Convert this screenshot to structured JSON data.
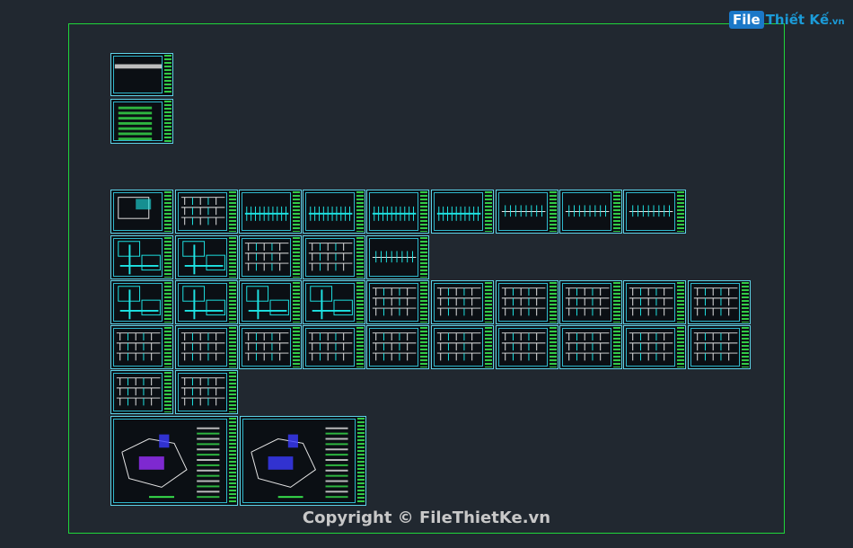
{
  "watermark": {
    "logo_prefix": "File",
    "logo_text": "Thiết Kế",
    "logo_suffix": ".vn",
    "copyright": "Copyright © FileThietKe.vn"
  },
  "colors": {
    "background": "#212830",
    "border": "#1fd63a",
    "sheet_frame": "#5fd3e8",
    "cyan_lines": "#1ee5e5",
    "title_block": "#37e04b",
    "plan_blue": "#3b3bff",
    "plan_purple": "#9b30ff"
  }
}
